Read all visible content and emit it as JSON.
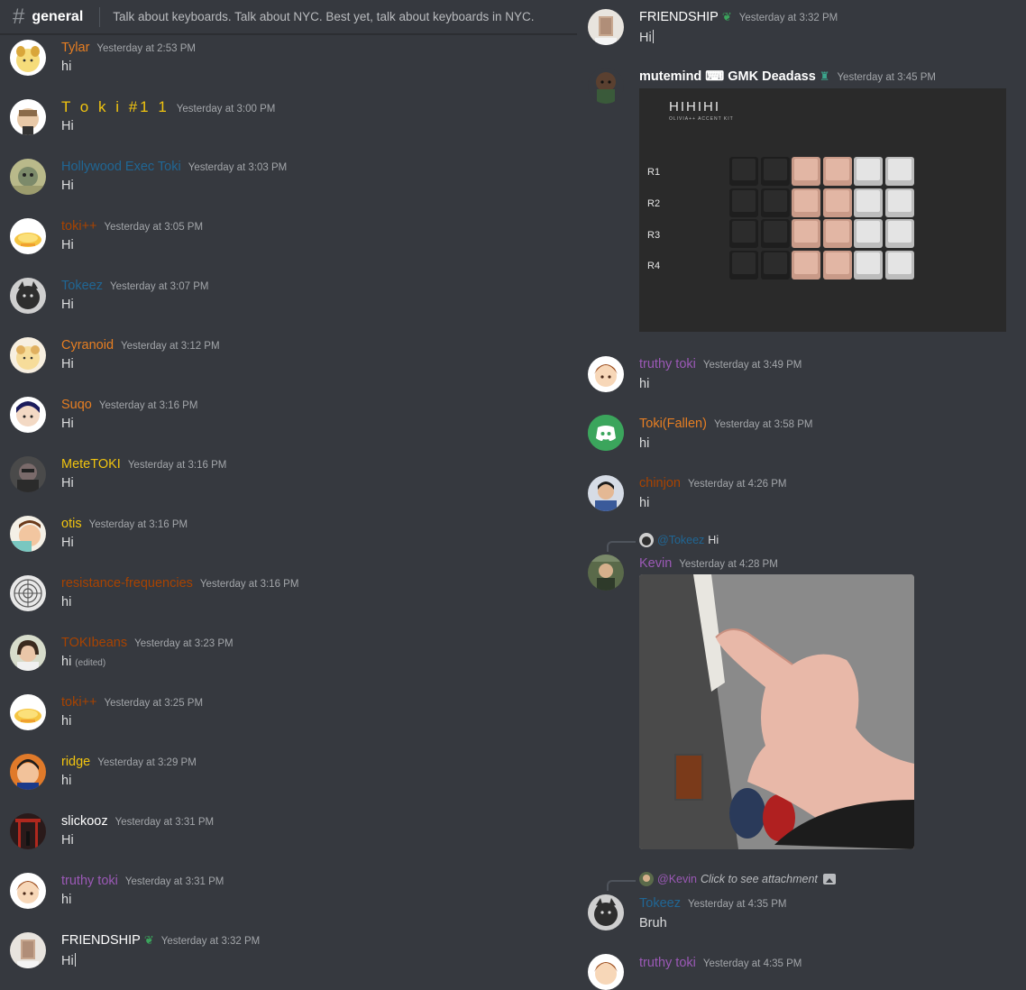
{
  "header": {
    "channel": "general",
    "topic": "Talk about keyboards. Talk about NYC. Best yet, talk about keyboards in NYC."
  },
  "colors": {
    "background": "#36393f",
    "orange": "#e67e22",
    "yellow": "#f1c40f",
    "blue": "#206694",
    "purple": "#9b59b6",
    "red": "#a84300",
    "green": "#3ba55c"
  },
  "left_messages": [
    {
      "user": "Tylar",
      "time": "Yesterday at 2:53 PM",
      "text": "hi"
    },
    {
      "user": "T o k i #1 1",
      "time": "Yesterday at 3:00 PM",
      "text": "Hi"
    },
    {
      "user": "Hollywood Exec Toki",
      "time": "Yesterday at 3:03 PM",
      "text": "Hi"
    },
    {
      "user": "toki++",
      "time": "Yesterday at 3:05 PM",
      "text": "Hi"
    },
    {
      "user": "Tokeez",
      "time": "Yesterday at 3:07 PM",
      "text": "Hi"
    },
    {
      "user": "Cyranoid",
      "time": "Yesterday at 3:12 PM",
      "text": "Hi"
    },
    {
      "user": "Suqo",
      "time": "Yesterday at 3:16 PM",
      "text": "Hi"
    },
    {
      "user": "MeteTOKI",
      "time": "Yesterday at 3:16 PM",
      "text": "Hi"
    },
    {
      "user": "otis",
      "time": "Yesterday at 3:16 PM",
      "text": "Hi"
    },
    {
      "user": "resistance-frequencies",
      "time": "Yesterday at 3:16 PM",
      "text": "hi"
    },
    {
      "user": "TOKIbeans",
      "time": "Yesterday at 3:23 PM",
      "text": "hi",
      "edited": "(edited)"
    },
    {
      "user": "toki++",
      "time": "Yesterday at 3:25 PM",
      "text": "hi"
    },
    {
      "user": "ridge",
      "time": "Yesterday at 3:29 PM",
      "text": "hi"
    },
    {
      "user": "slickooz",
      "time": "Yesterday at 3:31 PM",
      "text": "Hi"
    },
    {
      "user": "truthy toki",
      "time": "Yesterday at 3:31 PM",
      "text": "hi"
    },
    {
      "user": "FRIENDSHIP",
      "time": "Yesterday at 3:32 PM",
      "text": "Hi"
    }
  ],
  "right_messages": [
    {
      "user": "FRIENDSHIP",
      "time": "Yesterday at 3:32 PM",
      "text": "Hi"
    },
    {
      "user": "mutemind ⌨ GMK Deadass",
      "time": "Yesterday at 3:45 PM",
      "text": ""
    },
    {
      "user": "truthy toki",
      "time": "Yesterday at 3:49 PM",
      "text": "hi"
    },
    {
      "user": "Toki(Fallen)",
      "time": "Yesterday at 3:58 PM",
      "text": "hi"
    },
    {
      "user": "chinjon",
      "time": "Yesterday at 4:26 PM",
      "text": "hi"
    },
    {
      "user": "Kevin",
      "time": "Yesterday at 4:28 PM",
      "text": ""
    },
    {
      "user": "Tokeez",
      "time": "Yesterday at 4:35 PM",
      "text": "Bruh"
    },
    {
      "user": "truthy toki",
      "time": "Yesterday at 4:35 PM",
      "text": ""
    }
  ],
  "keyboard_embed": {
    "title": "HIHIHI",
    "subtitle": "OLIVIA++ ACCENT KIT",
    "rows": [
      "R1",
      "R2",
      "R3",
      "R4"
    ]
  },
  "replies": [
    {
      "mention": "@Tokeez",
      "text": "Hi"
    },
    {
      "mention": "@Kevin",
      "text": "Click to see attachment"
    }
  ]
}
